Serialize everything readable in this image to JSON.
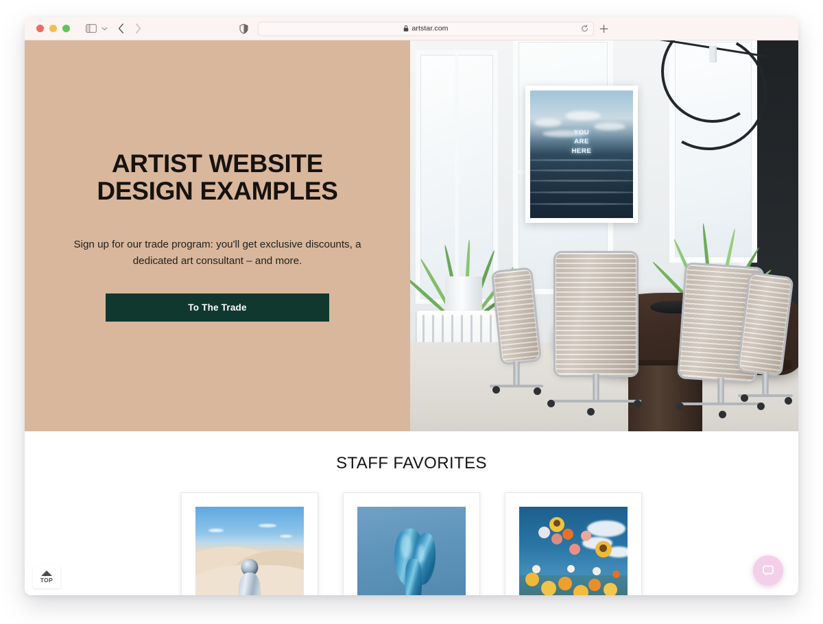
{
  "browser": {
    "traffic_lights": [
      "close",
      "minimize",
      "maximize"
    ],
    "sidebar_toggle_icon": "sidebar-icon",
    "chevron_icon": "chevron-down-icon",
    "back_icon": "chevron-left-icon",
    "forward_icon": "chevron-right-icon",
    "shield_icon": "privacy-shield-icon",
    "lock_icon": "lock-icon",
    "url": "artstar.com",
    "reload_icon": "reload-icon",
    "new_tab_icon": "plus-icon"
  },
  "hero": {
    "title": "ARTIST WEBSITE DESIGN EXAMPLES",
    "subtitle": "Sign up for our trade program: you'll get exclusive discounts, a dedicated art consultant – and more.",
    "cta_label": "To The Trade",
    "bg_color": "#d9b79c",
    "cta_color": "#10382e",
    "photo": {
      "scene": "modern-office-conference-room",
      "framed_art_text_lines": [
        "YOU",
        "ARE",
        "HERE"
      ],
      "elements": [
        "pendant-light",
        "potted-plant-left",
        "potted-plant-right",
        "radiator",
        "conference-table",
        "office-chairs",
        "windows",
        "doorway"
      ]
    }
  },
  "favorites": {
    "heading": "STAFF FAVORITES",
    "items": [
      {
        "name": "desert-mirror-figure-artwork",
        "alt": "Figure with mirrored helmet in desert dunes"
      },
      {
        "name": "blue-draped-fabric-artwork",
        "alt": "Blue draped fabric on blue background"
      },
      {
        "name": "wildflower-sky-artwork",
        "alt": "Sunflowers and wildflowers against blue sky"
      }
    ]
  },
  "widgets": {
    "scroll_top_label": "TOP",
    "scroll_top_icon": "caret-up-icon",
    "chat_icon": "chat-bubble-icon",
    "chat_color": "#f3cfe9"
  }
}
